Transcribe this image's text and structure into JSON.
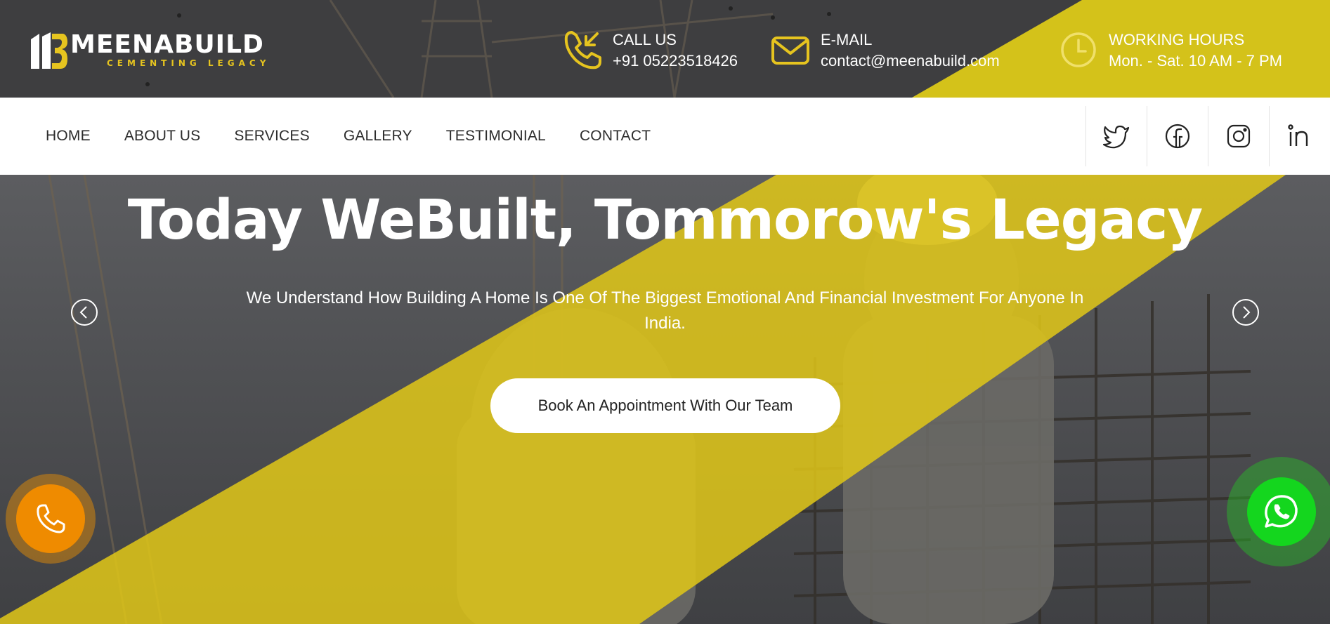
{
  "brand": {
    "name": "MEENABUILD",
    "tagline": "CEMENTING LEGACY",
    "accent": "#e6c41f"
  },
  "topbar": {
    "call": {
      "label": "CALL US",
      "value": "+91 05223518426",
      "icon": "phone-incoming-icon"
    },
    "email": {
      "label": "E-MAIL",
      "value": "contact@meenabuild.com",
      "icon": "envelope-icon"
    },
    "hours": {
      "label": "WORKING HOURS",
      "value": "Mon. - Sat. 10 AM - 7 PM",
      "icon": "clock-icon"
    }
  },
  "nav": {
    "items": [
      {
        "label": "HOME"
      },
      {
        "label": "ABOUT US"
      },
      {
        "label": "SERVICES"
      },
      {
        "label": "GALLERY"
      },
      {
        "label": "TESTIMONIAL"
      },
      {
        "label": "CONTACT"
      }
    ],
    "social": [
      "twitter-icon",
      "facebook-icon",
      "instagram-icon",
      "linkedin-icon"
    ]
  },
  "hero": {
    "title": "Today WeBuilt, Tommorow's Legacy",
    "subtitle": "We Understand How Building A Home Is One Of The Biggest Emotional And Financial Investment For Anyone In India.",
    "cta": "Book An Appointment With Our Team"
  },
  "colors": {
    "yellow": "#d4c21a",
    "call_fab": "#ef8b00",
    "whatsapp_fab": "#14d61e"
  }
}
